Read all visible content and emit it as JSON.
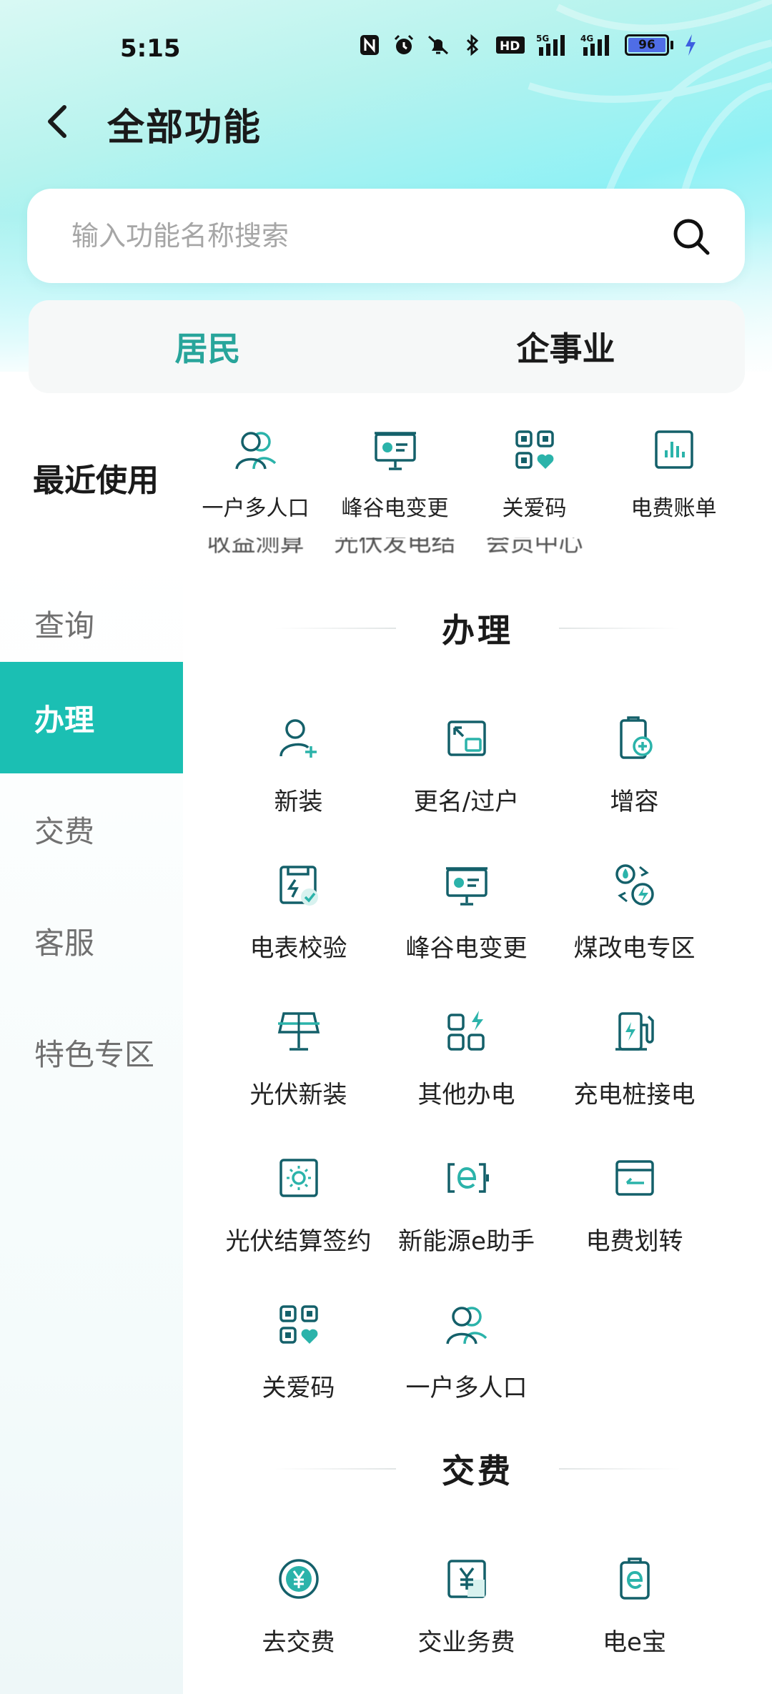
{
  "status_bar": {
    "time": "5:15",
    "battery": "96",
    "net1": "5G",
    "net2": "4G",
    "hd": "HD"
  },
  "header": {
    "title": "全部功能"
  },
  "search": {
    "placeholder": "输入功能名称搜索"
  },
  "segments": [
    {
      "label": "居民",
      "active": true
    },
    {
      "label": "企事业",
      "active": false
    }
  ],
  "recent": {
    "label": "最近使用",
    "items": [
      {
        "label": "一户多人口",
        "icon": "multi-person-icon"
      },
      {
        "label": "峰谷电变更",
        "icon": "peak-valley-icon"
      },
      {
        "label": "关爱码",
        "icon": "care-code-icon"
      },
      {
        "label": "电费账单",
        "icon": "bill-chart-icon"
      }
    ],
    "cutoff_row": [
      "收益测算",
      "光伏发电结算",
      "会员中心"
    ]
  },
  "sidebar": {
    "items": [
      {
        "label": "查询",
        "active": false
      },
      {
        "label": "办理",
        "active": true
      },
      {
        "label": "交费",
        "active": false
      },
      {
        "label": "客服",
        "active": false
      },
      {
        "label": "特色专区",
        "active": false
      }
    ]
  },
  "sections": [
    {
      "title": "办理",
      "items": [
        {
          "label": "新装",
          "icon": "add-user-icon"
        },
        {
          "label": "更名/过户",
          "icon": "transfer-icon"
        },
        {
          "label": "增容",
          "icon": "capacity-increase-icon"
        },
        {
          "label": "电表校验",
          "icon": "meter-check-icon"
        },
        {
          "label": "峰谷电变更",
          "icon": "peak-valley-icon"
        },
        {
          "label": "煤改电专区",
          "icon": "coal-to-electric-icon"
        },
        {
          "label": "光伏新装",
          "icon": "solar-panel-icon"
        },
        {
          "label": "其他办电",
          "icon": "other-power-icon"
        },
        {
          "label": "充电桩接电",
          "icon": "charging-pile-icon"
        },
        {
          "label": "光伏结算签约",
          "icon": "solar-settlement-icon"
        },
        {
          "label": "新能源e助手",
          "icon": "e-assistant-icon"
        },
        {
          "label": "电费划转",
          "icon": "fee-transfer-icon"
        },
        {
          "label": "关爱码",
          "icon": "care-code-icon"
        },
        {
          "label": "一户多人口",
          "icon": "multi-person-icon"
        }
      ]
    },
    {
      "title": "交费",
      "items": [
        {
          "label": "去交费",
          "icon": "pay-icon"
        },
        {
          "label": "交业务费",
          "icon": "business-fee-icon"
        },
        {
          "label": "电e宝",
          "icon": "e-wallet-icon"
        }
      ]
    }
  ],
  "colors": {
    "accent": "#1bbfb3",
    "accent_text": "#28a59b",
    "icon_dark": "#14606a",
    "icon_teal": "#2bb3aa"
  }
}
